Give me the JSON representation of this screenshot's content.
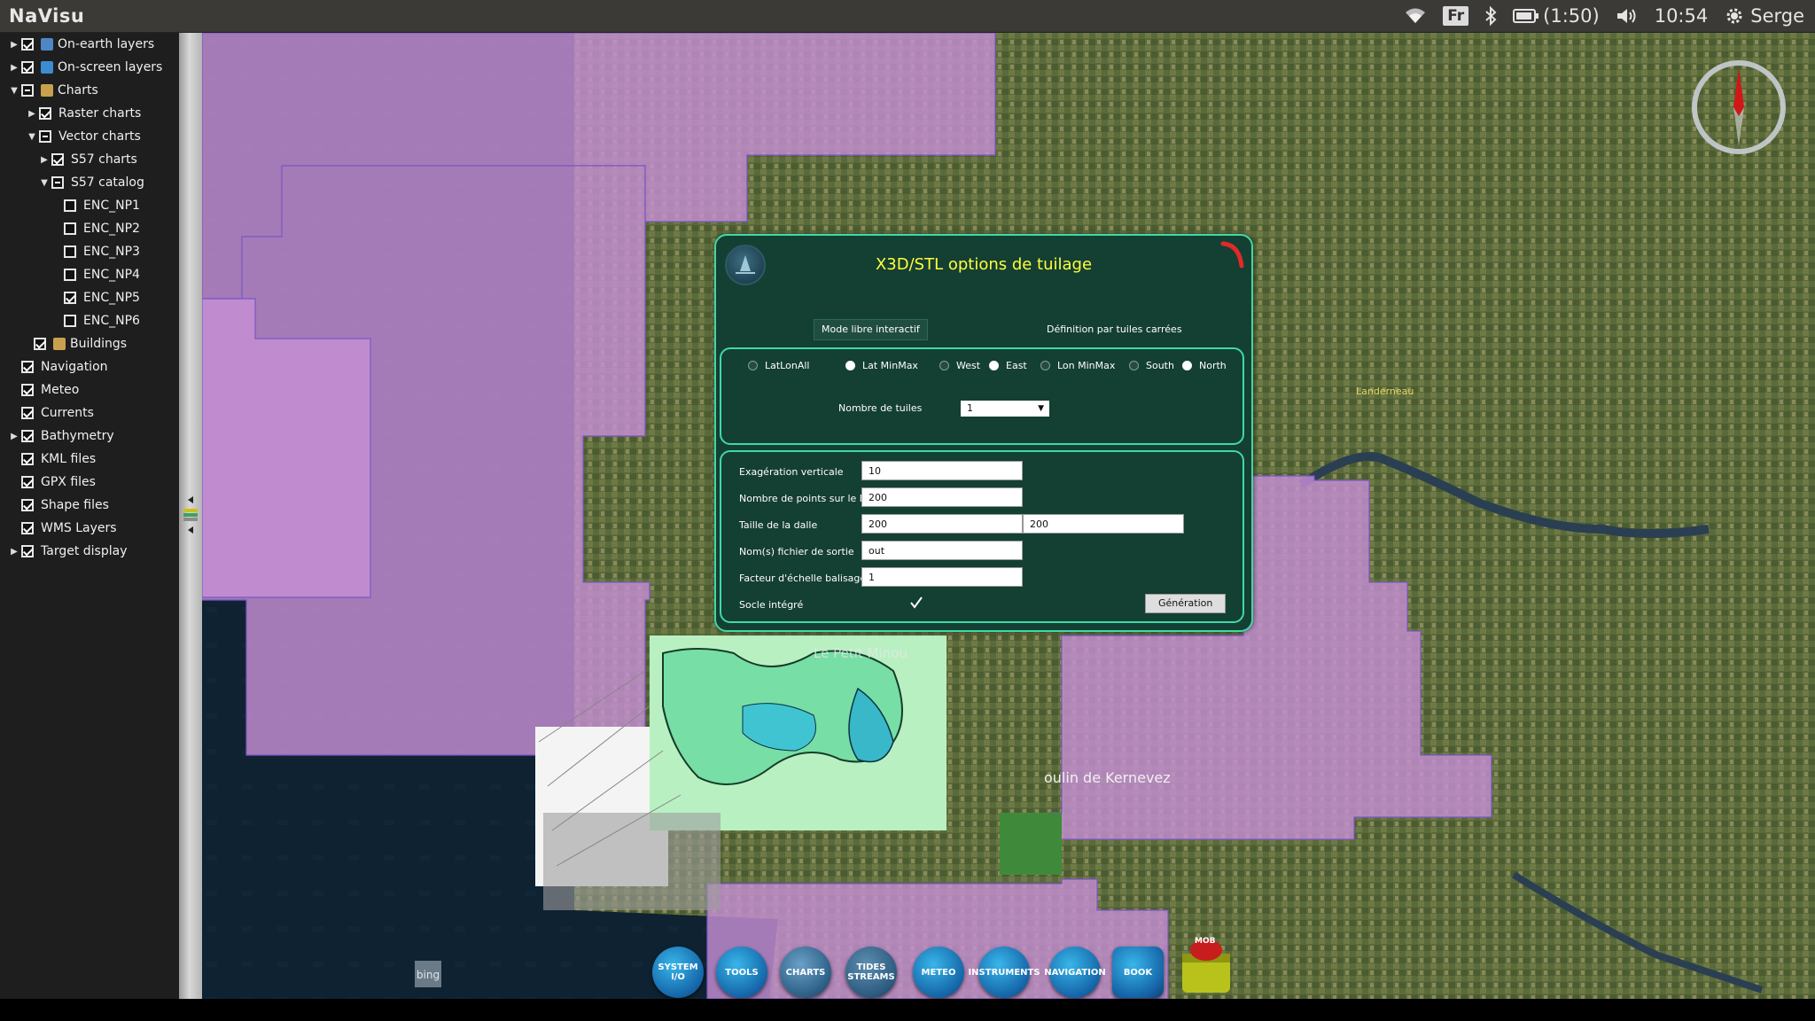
{
  "app": {
    "title": "NaVisu"
  },
  "tray": {
    "keyboard": "Fr",
    "battery": "(1:50)",
    "time": "10:54",
    "user": "Serge"
  },
  "layers": [
    {
      "label": "On-earth layers",
      "state": "checked",
      "arrow": "▶",
      "icon": "layers-icon"
    },
    {
      "label": "On-screen layers",
      "state": "checked",
      "arrow": "▶",
      "icon": "screen-icon"
    },
    {
      "label": "Charts",
      "state": "partial",
      "arrow": "▼",
      "icon": "charts-icon"
    },
    {
      "label": "Raster charts",
      "state": "checked",
      "arrow": "▶"
    },
    {
      "label": "Vector charts",
      "state": "partial",
      "arrow": "▼"
    },
    {
      "label": "S57 charts",
      "state": "checked",
      "arrow": "▶"
    },
    {
      "label": "S57 catalog",
      "state": "partial",
      "arrow": "▼"
    },
    {
      "label": "ENC_NP1",
      "state": "unchecked"
    },
    {
      "label": "ENC_NP2",
      "state": "unchecked"
    },
    {
      "label": "ENC_NP3",
      "state": "unchecked"
    },
    {
      "label": "ENC_NP4",
      "state": "unchecked"
    },
    {
      "label": "ENC_NP5",
      "state": "checked"
    },
    {
      "label": "ENC_NP6",
      "state": "unchecked"
    },
    {
      "label": "Buildings",
      "state": "checked",
      "icon": "buildings-icon"
    },
    {
      "label": "Navigation",
      "state": "checked"
    },
    {
      "label": "Meteo",
      "state": "checked"
    },
    {
      "label": "Currents",
      "state": "checked"
    },
    {
      "label": "Bathymetry",
      "state": "checked",
      "arrow": "▶"
    },
    {
      "label": "KML files",
      "state": "checked"
    },
    {
      "label": "GPX files",
      "state": "checked"
    },
    {
      "label": "Shape files",
      "state": "checked"
    },
    {
      "label": "WMS Layers",
      "state": "checked"
    },
    {
      "label": "Target display",
      "state": "checked",
      "arrow": "▶"
    }
  ],
  "map": {
    "label_landerneau": "Landerneau",
    "label_petit_minou": "Le Petit Minou",
    "label_kernevez": "oulin de Kernevez",
    "attribution": "bing"
  },
  "dialog": {
    "title": "X3D/STL options de tuilage",
    "tab_free": "Mode libre interactif",
    "tab_square": "Définition par tuiles carrées",
    "radios": {
      "latlonall": "LatLonAll",
      "lat_minmax": "Lat MinMax",
      "west": "West",
      "east": "East",
      "lon_minmax": "Lon MinMax",
      "south": "South",
      "north": "North"
    },
    "tiles_label": "Nombre de tuiles",
    "tiles_value": "1",
    "fields": {
      "exag_label": "Exagération verticale",
      "exag_value": "10",
      "points_label": "Nombre de points sur le MNT",
      "points_value": "200",
      "slab_label": "Taille de la dalle",
      "slab_value_1": "200",
      "slab_value_2": "200",
      "output_label": "Nom(s) fichier de sortie",
      "output_value": "out",
      "scale_label": "Facteur d'échelle balisage",
      "scale_value": "1",
      "base_label": "Socle intégré"
    },
    "generate": "Génération"
  },
  "toolbar": {
    "system": "SYSTEM I/O",
    "tools": "TOOLS",
    "charts": "CHARTS",
    "tides": "TIDES STREAMS",
    "meteo": "METEO",
    "instruments": "INSTRUMENTS",
    "navigation": "NAVIGATION",
    "book": "BOOK",
    "mob": "MOB"
  },
  "colors": {
    "chart_overlay": "#c68fd4",
    "dialog_bg": "#143f33",
    "dialog_border": "#3fd9a7",
    "dialog_title": "#ffff3a"
  }
}
